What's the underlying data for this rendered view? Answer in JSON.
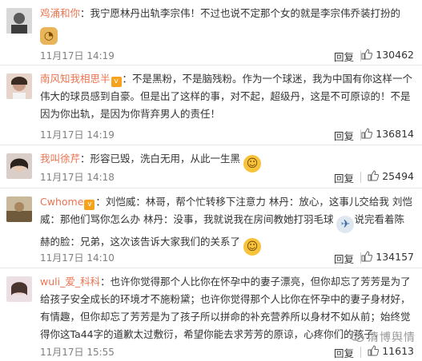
{
  "comments": [
    {
      "username": "鸡涌和你",
      "has_badge": false,
      "text": "：我宁愿林丹出轨李宗伟！不过也说不定那个女的就是李宗伟乔装打扮的",
      "emoji": "doge-icon",
      "time": "11月17日 14:19",
      "reply_label": "回复",
      "likes": "130462"
    },
    {
      "username": "南风知我相思半",
      "has_badge": true,
      "text": "：不是黑粉，不是脑残粉。作为一个球迷，我为中国有你这样一个伟大的球员感到自豪。但是出了这样的事，对不起，超级丹，这是不可原谅的！不是因为你出轨，是因为你背弃男人的责任！",
      "emoji": "",
      "time": "11月17日 14:19",
      "reply_label": "回复",
      "likes": "136814"
    },
    {
      "username": "我叫徐芹",
      "has_badge": false,
      "text": "：形容已毁，洗白无用，从此一生黑",
      "emoji": "smile-icon",
      "time": "11月17日 14:18",
      "reply_label": "回复",
      "likes": "25494"
    },
    {
      "username": "Cwhome",
      "has_badge": true,
      "text_part1": "：刘恺威：林哥，帮个忙转移下注意力 林丹：放心，这事儿交给我 刘恺威：那他们骂你怎么办 林丹：没事，我就说我在房间教她打羽毛球",
      "text_part2": "说完看着陈赫的脸：兄弟，这次该告诉大家我们的关系了",
      "time": "11月17日 14:10",
      "reply_label": "回复",
      "likes": "134157"
    },
    {
      "username": "wuli_爱_科科",
      "has_badge": false,
      "text": "：也许你觉得那个人比你在怀孕中的妻子漂亮，但你却忘了芳芳是为了给孩子安全成长的环境才不施粉黛；也许你觉得那个人比你在怀孕中的妻子身材好，有情趣，但你却忘了芳芳是为了孩子所以拼命的补充营养所以身材不如从前；始终觉得你这Ta44字的道歉太过敷衍，希望你能去求芳芳的原谅，心疼你们的孩子，",
      "time": "11月17日 15:55",
      "reply_label": "回复",
      "likes": "11613"
    }
  ],
  "watermark": "清博舆情",
  "colors": {
    "username": "#eb7350",
    "time": "#808080",
    "badge": "#f6a21d"
  }
}
